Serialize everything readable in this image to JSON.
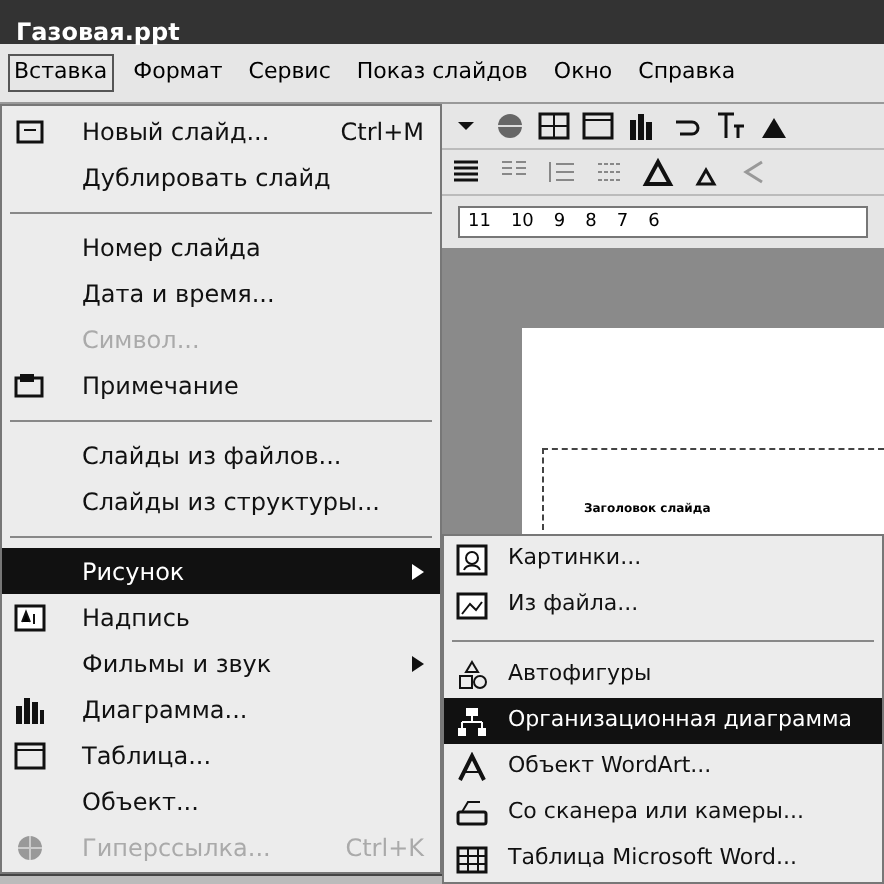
{
  "window": {
    "title": "Газовая.ppt"
  },
  "menubar": [
    {
      "label": "Вставка",
      "selected": true
    },
    {
      "label": "Формат",
      "selected": false
    },
    {
      "label": "Сервис",
      "selected": false
    },
    {
      "label": "Показ слайдов",
      "selected": false
    },
    {
      "label": "Окно",
      "selected": false
    },
    {
      "label": "Справка",
      "selected": false
    }
  ],
  "ruler": [
    "11",
    "10",
    "9",
    "8",
    "7",
    "6"
  ],
  "slide": {
    "title": "Заголовок слайда"
  },
  "menu": [
    {
      "kind": "item",
      "label": "Новый слайд...",
      "shortcut": "Ctrl+M",
      "disabled": false,
      "selected": false,
      "submenu": false
    },
    {
      "kind": "item",
      "label": "Дублировать слайд",
      "disabled": false,
      "selected": false,
      "submenu": false
    },
    {
      "kind": "separator"
    },
    {
      "kind": "item",
      "label": "Номер слайда",
      "disabled": false,
      "selected": false,
      "submenu": false
    },
    {
      "kind": "item",
      "label": "Дата и время...",
      "disabled": false,
      "selected": false,
      "submenu": false
    },
    {
      "kind": "item",
      "label": "Символ...",
      "disabled": true,
      "selected": false,
      "submenu": false
    },
    {
      "kind": "item",
      "label": "Примечание",
      "disabled": false,
      "selected": false,
      "submenu": false
    },
    {
      "kind": "separator"
    },
    {
      "kind": "item",
      "label": "Слайды из файлов...",
      "disabled": false,
      "selected": false,
      "submenu": false
    },
    {
      "kind": "item",
      "label": "Слайды из структуры...",
      "disabled": false,
      "selected": false,
      "submenu": false
    },
    {
      "kind": "separator"
    },
    {
      "kind": "item",
      "label": "Рисунок",
      "disabled": false,
      "selected": true,
      "submenu": true
    },
    {
      "kind": "item",
      "label": "Надпись",
      "disabled": false,
      "selected": false,
      "submenu": false
    },
    {
      "kind": "item",
      "label": "Фильмы и звук",
      "disabled": false,
      "selected": false,
      "submenu": true
    },
    {
      "kind": "item",
      "label": "Диаграмма...",
      "disabled": false,
      "selected": false,
      "submenu": false
    },
    {
      "kind": "item",
      "label": "Таблица...",
      "disabled": false,
      "selected": false,
      "submenu": false
    },
    {
      "kind": "item",
      "label": "Объект...",
      "disabled": false,
      "selected": false,
      "submenu": false
    },
    {
      "kind": "item",
      "label": "Гиперссылка...",
      "shortcut": "Ctrl+K",
      "disabled": true,
      "selected": false,
      "submenu": false
    }
  ],
  "submenu": [
    {
      "kind": "item",
      "label": "Картинки...",
      "selected": false
    },
    {
      "kind": "item",
      "label": "Из файла...",
      "selected": false
    },
    {
      "kind": "separator"
    },
    {
      "kind": "item",
      "label": "Автофигуры",
      "selected": false
    },
    {
      "kind": "item",
      "label": "Организационная диаграмма",
      "selected": true
    },
    {
      "kind": "item",
      "label": "Объект WordArt...",
      "selected": false
    },
    {
      "kind": "item",
      "label": "Со сканера или камеры...",
      "selected": false
    },
    {
      "kind": "item",
      "label": "Таблица Microsoft Word...",
      "selected": false
    }
  ]
}
